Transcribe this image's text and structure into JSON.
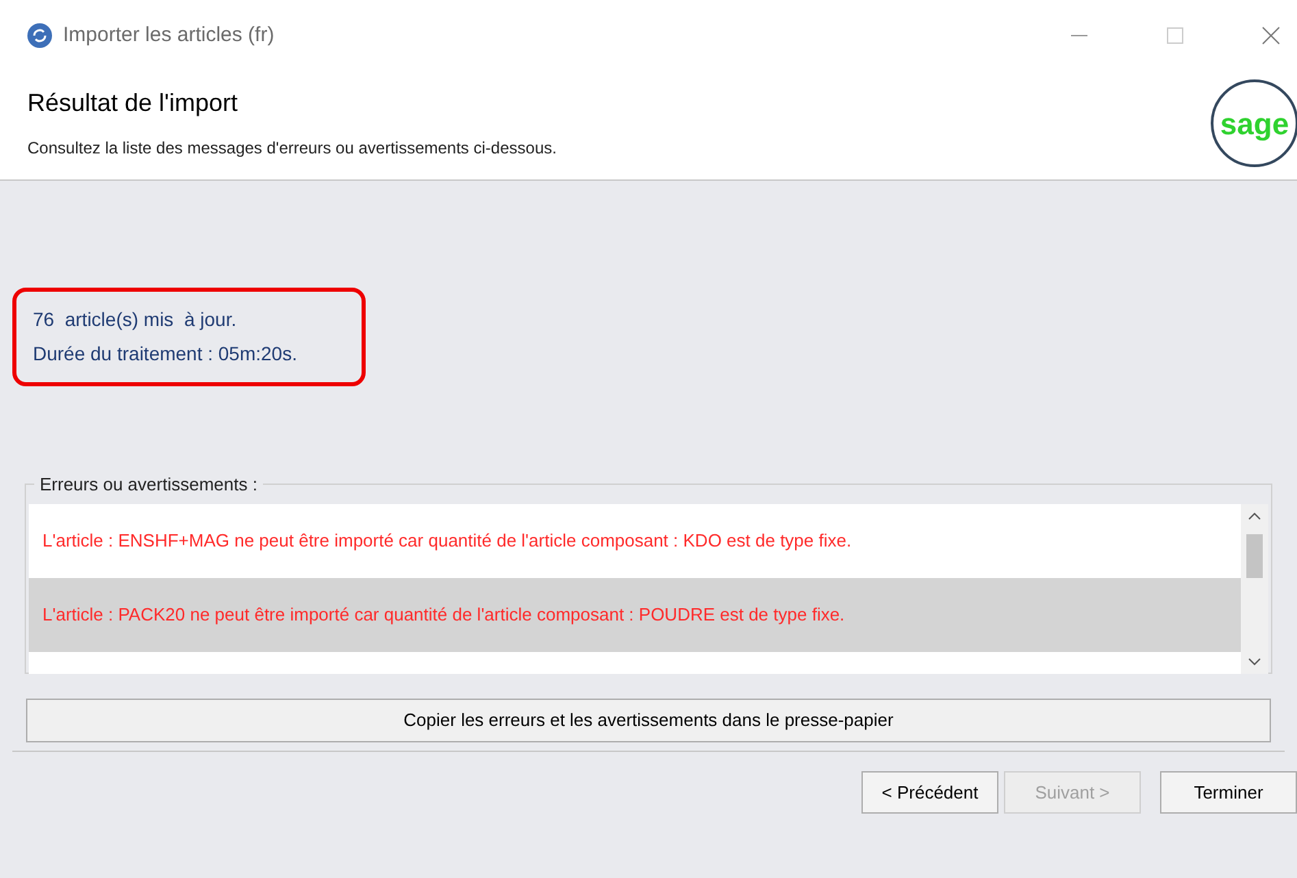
{
  "window": {
    "title": "Importer les articles (fr)"
  },
  "header": {
    "title": "Résultat de l'import",
    "subtitle": "Consultez la liste des messages d'erreurs ou avertissements ci-dessous.",
    "logo": "sage"
  },
  "result": {
    "lines": [
      "76  article(s) mis  à jour.",
      "Durée du traitement : 05m:20s."
    ],
    "highlighted": true
  },
  "messages": {
    "label": "Erreurs ou avertissements :",
    "rows": [
      {
        "text": "L'article : ENSHF+MAG ne peut être importé car quantité de l'article composant : KDO est de type fixe.",
        "selected": false
      },
      {
        "text": "L'article : PACK20 ne peut être importé car quantité de l'article composant : POUDRE est de type fixe.",
        "selected": true
      }
    ]
  },
  "copy_button": "Copier les erreurs et les avertissements dans le presse-papier",
  "buttons": [
    {
      "label": "< Précédent",
      "disabled": false
    },
    {
      "label": "Suivant >",
      "disabled": true
    },
    {
      "label": "Terminer",
      "disabled": false
    }
  ]
}
